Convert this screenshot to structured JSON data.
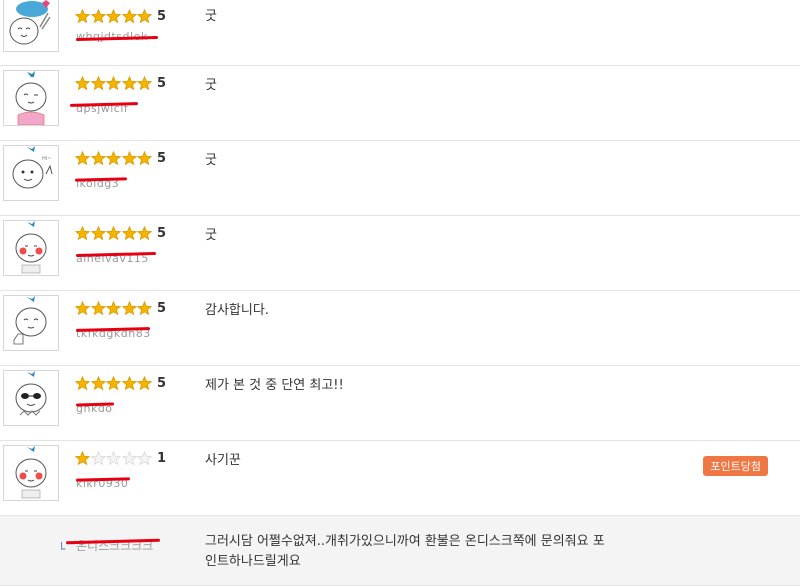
{
  "reviews": [
    {
      "rating": 5,
      "score_label": "5",
      "user_id": "whqjdtsdlek",
      "comment": "굿",
      "avatar": "baby-cloud-heart-avatar"
    },
    {
      "rating": 5,
      "score_label": "5",
      "user_id": "dpsjwlclf",
      "comment": "굿",
      "avatar": "baby-wink-avatar"
    },
    {
      "rating": 5,
      "score_label": "5",
      "user_id": "lkoldg3",
      "comment": "굿",
      "avatar": "baby-hello-avatar"
    },
    {
      "rating": 5,
      "score_label": "5",
      "user_id": "alnelvav115",
      "comment": "굿",
      "avatar": "baby-blush-avatar"
    },
    {
      "rating": 5,
      "score_label": "5",
      "user_id": "tkfkdgkdh83",
      "comment": "감사합니다.",
      "avatar": "baby-thumbsup-avatar"
    },
    {
      "rating": 5,
      "score_label": "5",
      "user_id": "ghkdo",
      "comment": "제가 본 것 중 단연 최고!!",
      "avatar": "baby-sunglasses-avatar"
    },
    {
      "rating": 1,
      "score_label": "1",
      "user_id": "kikr0930",
      "comment": "사기꾼",
      "avatar": "baby-blush-avatar",
      "badge": "포인트당첨"
    }
  ],
  "reply": {
    "arrow": "└",
    "user_id": "온디스크크크크",
    "text": "그러시담 어쩔수없져..개취가있으니까여 환불은 온디스크쪽에 문의줘요 포인트하나드릴게요"
  },
  "colors": {
    "star_on": "#f5b400",
    "star_off": "#d8d8d8",
    "redaction": "#e60012",
    "badge": "#ee7744"
  }
}
